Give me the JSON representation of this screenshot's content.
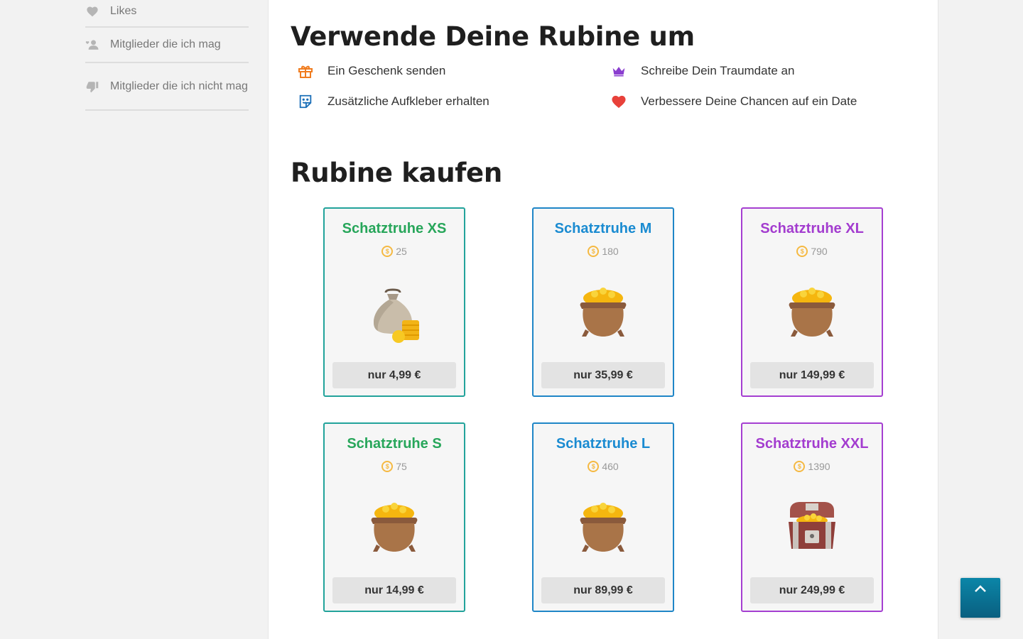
{
  "sidebar": {
    "items": [
      {
        "label": "Likes",
        "icon": "heart-icon"
      },
      {
        "label": "Mitglieder die ich mag",
        "icon": "user-liked-icon"
      },
      {
        "label": "Mitglieder die ich nicht mag",
        "icon": "thumbs-down-icon"
      }
    ]
  },
  "uses": {
    "title": "Verwende Deine Rubine um",
    "items": [
      {
        "label": "Ein Geschenk senden",
        "icon": "gift-icon"
      },
      {
        "label": "Schreibe Dein Traumdate an",
        "icon": "crown-icon"
      },
      {
        "label": "Zusätzliche Aufkleber erhalten",
        "icon": "sticker-icon"
      },
      {
        "label": "Verbessere Deine Chancen auf ein Date",
        "icon": "heart-icon"
      }
    ]
  },
  "shop": {
    "title": "Rubine kaufen",
    "packages": [
      {
        "name": "Schatztruhe XS",
        "amount": "25",
        "price": "nur 4,99 €",
        "image": "money-bag-icon"
      },
      {
        "name": "Schatztruhe M",
        "amount": "180",
        "price": "nur 35,99 €",
        "image": "gold-pot-icon"
      },
      {
        "name": "Schatztruhe XL",
        "amount": "790",
        "price": "nur 149,99 €",
        "image": "gold-pot-icon"
      },
      {
        "name": "Schatztruhe S",
        "amount": "75",
        "price": "nur 14,99 €",
        "image": "gold-pot-icon"
      },
      {
        "name": "Schatztruhe L",
        "amount": "460",
        "price": "nur 89,99 €",
        "image": "gold-pot-icon"
      },
      {
        "name": "Schatztruhe XXL",
        "amount": "1390",
        "price": "nur 249,99 €",
        "image": "treasure-chest-icon"
      }
    ]
  },
  "colors": {
    "green": "#27a65a",
    "blue": "#1a8bd1",
    "purple": "#a33ccf",
    "coin": "#f5b942",
    "scroll_button": "#0a7596"
  }
}
